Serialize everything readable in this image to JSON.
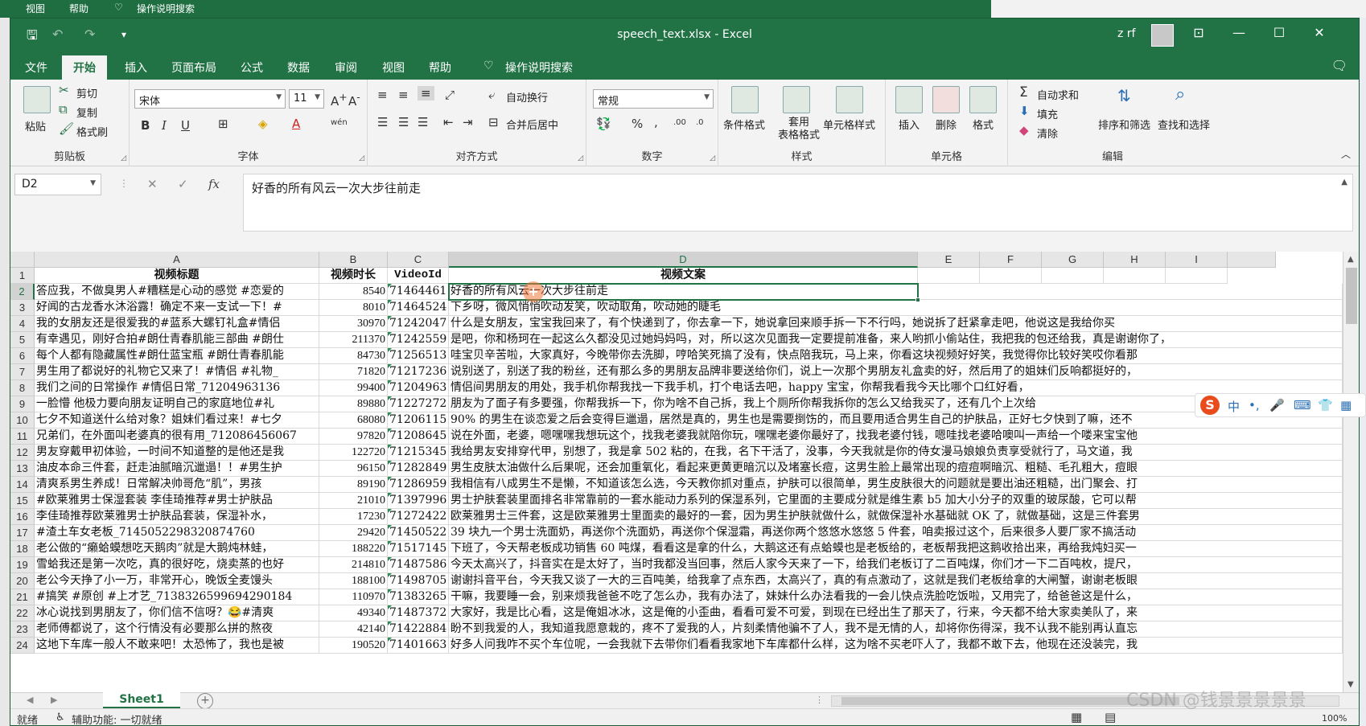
{
  "background": {
    "menu_view": "视图",
    "menu_help": "帮助",
    "tell_me": "操作说明搜索"
  },
  "window": {
    "title": "speech_text.xlsx - Excel",
    "user": "z rf",
    "accent": "#217346"
  },
  "tabs": [
    {
      "label": "文件",
      "active": false
    },
    {
      "label": "开始",
      "active": true
    },
    {
      "label": "插入",
      "active": false
    },
    {
      "label": "页面布局",
      "active": false
    },
    {
      "label": "公式",
      "active": false
    },
    {
      "label": "数据",
      "active": false
    },
    {
      "label": "审阅",
      "active": false
    },
    {
      "label": "视图",
      "active": false
    },
    {
      "label": "帮助",
      "active": false
    },
    {
      "label": "操作说明搜索",
      "active": false
    }
  ],
  "ribbon": {
    "clipboard": {
      "paste": "粘贴",
      "cut": "剪切",
      "copy": "复制",
      "format_painter": "格式刷",
      "label": "剪贴板"
    },
    "font": {
      "name": "宋体",
      "size": "11",
      "label": "字体",
      "bold": "B",
      "italic": "I",
      "underline": "U",
      "phonetic": "wén"
    },
    "alignment": {
      "wrap": "自动换行",
      "merge": "合并后居中",
      "label": "对齐方式"
    },
    "number": {
      "format": "常规",
      "percent": "%",
      "comma": ",",
      "label": "数字"
    },
    "styles": {
      "conditional": "条件格式",
      "table": "套用\n表格格式",
      "cell_styles": "单元格样式",
      "label": "样式"
    },
    "cells": {
      "insert": "插入",
      "delete": "删除",
      "format": "格式",
      "label": "单元格"
    },
    "editing": {
      "autosum": "自动求和",
      "fill": "填充",
      "clear": "清除",
      "sort": "排序和筛选",
      "find": "查找和选择",
      "label": "编辑"
    }
  },
  "formula_bar": {
    "name_box": "D2",
    "fx": "fx",
    "content": "好香的所有风云一次大步往前走"
  },
  "columns": [
    "A",
    "B",
    "C",
    "D",
    "E",
    "F",
    "G",
    "H",
    "I"
  ],
  "selected_column": "D",
  "selected_row": 2,
  "header_row": {
    "a": "视频标题",
    "b": "视频时长",
    "c": "VideoId",
    "d": "视频文案"
  },
  "rows": [
    {
      "num": "2",
      "a": "答应我，不做臭男人#糟糕是心动的感觉 #恋爱的",
      "b": "8540",
      "c": "71464461",
      "d": "好香的所有风云一次大步往前走"
    },
    {
      "num": "3",
      "a": "好闻的古龙香水沐浴露！确定不来一支试一下！#",
      "b": "8010",
      "c": "71464524",
      "d": "下乡呀，微风悄悄吹动发笑，吹动取角，吹动她的睫毛"
    },
    {
      "num": "4",
      "a": "我的女朋友还是很爱我的#蓝系大螺钉礼盒#情侣",
      "b": "30970",
      "c": "71242047",
      "d": "什么是女朋友，宝宝我回来了，有个快递到了，你去拿一下，她说拿回来顺手拆一下不行吗，她说拆了赶紧拿走吧，他说这是我给你买"
    },
    {
      "num": "5",
      "a": "有幸遇见，刚好合拍#朗仕青春肌能三部曲 #朗仕",
      "b": "211370",
      "c": "71242559",
      "d": "是吧，你和杨珂在一起这么久都没见过她妈妈吗，对，所以这次见面我一定要提前准备，来人哟抓小偷站住，我把我的包还给我，真是谢谢你了，"
    },
    {
      "num": "6",
      "a": "每个人都有隐藏属性#朗仕蓝宝瓶 #朗仕青春肌能",
      "b": "84730",
      "c": "71256513",
      "d": "哇宝贝辛苦啦，大家真好，今晚带你去洗脚，哼哈笑死搞了没有，快点陪我玩，马上来，你看这块视频好好笑，我觉得你比较好笑哎你看那"
    },
    {
      "num": "7",
      "a": "男生用了都说好的礼物它又来了！#情侣 #礼物_",
      "b": "71820",
      "c": "71217236",
      "d": "说别送了，别送了我的粉丝，还有那么多的男朋友品牌非要送给你们，说上一次那个男朋友礼盒卖的好，然后用了的姐妹们反响都挺好的，"
    },
    {
      "num": "8",
      "a": "我们之间的日常操作 #情侣日常_71204963136",
      "b": "99400",
      "c": "71204963",
      "d": "情侣间男朋友的用处，我手机你帮我找一下我手机，打个电话去吧，happy 宝宝，你帮我看我今天比哪个口红好看，"
    },
    {
      "num": "9",
      "a": "一脸懵  他极力要向朋友证明自己的家庭地位#礼",
      "b": "89880",
      "c": "71227272",
      "d": "朋友为了面子有多要强，你帮我拆一下，你为啥不自己拆，我上个厕所你帮我拆你的怎么又给我买了，还有几个上次给"
    },
    {
      "num": "10",
      "a": "七夕不知道送什么给对象？姐妹们看过来！#七夕",
      "b": "68080",
      "c": "71206115",
      "d": "90% 的男生在谈恋爱之后会变得巨邋遢，居然是真的，男生也是需要捯饬的，而且要用适合男生自己的护肤品，正好七夕快到了嘛，还不"
    },
    {
      "num": "11",
      "a": "兄弟们，在外面叫老婆真的很有用_712086456067",
      "b": "97820",
      "c": "71208645",
      "d": "说在外面，老婆，嗯嘿嘿我想玩这个，找我老婆我就陪你玩，嘿嘿老婆你最好了，找我老婆付钱，嗯哇找老婆哈噢叫一声给一个喽来宝宝他"
    },
    {
      "num": "12",
      "a": "男友穿戴甲初体验，一时间不知道整的是他还是我",
      "b": "122720",
      "c": "71215345",
      "d": "我给男友安排穿代甲，别想了，我是拿 502 粘的，在我，名下干活了，没事，今天我就是你的侍女漫马娘娘负责享受就行了，马文道，我"
    },
    {
      "num": "13",
      "a": "油皮本命三件套，赶走油腻暗沉邋遢！！#男生护",
      "b": "96150",
      "c": "71282849",
      "d": "男生皮肤太油做什么后果呢，还会加重氧化，看起来更黄更暗沉以及堵塞长痘，这男生脸上最常出现的痘痘啊暗沉、粗糙、毛孔粗大，痘眼"
    },
    {
      "num": "14",
      "a": "清爽系男生养成！日常解决帅哥危“肌”，男孩",
      "b": "89190",
      "c": "71286959",
      "d": "我相信有八成男生不是懒，不知道该怎么选，今天教你抓对重点，护肤可以很简单，男生皮肤很大的问题就是要出油还粗糙，出门聚会、打"
    },
    {
      "num": "15",
      "a": "#欧莱雅男士保湿套装 李佳琦推荐#男士护肤品",
      "b": "21010",
      "c": "71397996",
      "d": "男士护肤套装里面排名非常靠前的一套水能动力系列的保湿系列，它里面的主要成分就是维生素 b5 加大小分子的双重的玻尿酸，它可以帮"
    },
    {
      "num": "16",
      "a": "李佳琦推荐欧莱雅男士护肤品套装，保湿补水，",
      "b": "17230",
      "c": "71272422",
      "d": "欧莱雅男士三件套，这是欧莱雅男士里面卖的最好的一套，因为男生护肤就做什么，就做保湿补水基础就 OK 了，就做基础，这是三件套男"
    },
    {
      "num": "17",
      "a": "#渣土车女老板_7145052298320874760",
      "b": "29420",
      "c": "71450522",
      "d": "39 块九一个男士洗面奶，再送你个洗面奶，再送你个保湿霜，再送你两个悠悠水悠悠 5 件套，咱卖报过这个，后来很多人要厂家不搞活动"
    },
    {
      "num": "18",
      "a": "老公做的“癞蛤蟆想吃天鹅肉”就是大鹅炖林蛙，",
      "b": "188220",
      "c": "71517145",
      "d": "下班了，今天帮老板成功销售 60 吨煤，看看这是拿的什么，大鹅这还有点蛤蟆也是老板给的，老板帮我把这鹅收拾出来，再给我炖妇买一"
    },
    {
      "num": "19",
      "a": "雪蛤我还是第一次吃，真的很好吃，烧卖蒸的也好",
      "b": "214810",
      "c": "71487586",
      "d": "今天太高兴了，抖音实在是太好了，当时我都没当回事，然后人家今天来了一下，给我们老板订了二百吨煤，你们才一下二百吨枚，提尺，"
    },
    {
      "num": "20",
      "a": "老公今天挣了小一万，非常开心，晚饭全麦馒头",
      "b": "188100",
      "c": "71498705",
      "d": "谢谢抖音平台，今天我又谈了一大的三百吨美，给我拿了点东西，太高兴了，真的有点激动了，这就是我们老板给拿的大闸蟹，谢谢老板眼"
    },
    {
      "num": "21",
      "a": "#搞笑 #原创 #上才艺_7138326599694290184",
      "b": "110970",
      "c": "71383265",
      "d": "干嘛，我要睡一会，别来烦我爸爸不吃了怎么办，我有办法了，妹妹什么办法看我的一会儿快点洗脸吃饭啦，又用完了，给爸爸这是什么，"
    },
    {
      "num": "22",
      "a": "冰心说找到男朋友了，你们信不信呀？😂#清爽",
      "b": "49340",
      "c": "71487372",
      "d": "大家好，我是比心看，这是俺姐冰冰，这是俺的小歪曲，看看可爱不可爱，到现在已经出生了那天了，行来，今天都不给大家卖美队了，来"
    },
    {
      "num": "23",
      "a": "老师傅都说了，这个行情没有必要那么拼的熬夜",
      "b": "42140",
      "c": "71422884",
      "d": "盼不到我爱的人，我知道我愿意栽的，疼不了爱我的人，片刻柔情他骗不了人，我不是无情的人，却将你伤得深，我不认我不能别再认直忘"
    },
    {
      "num": "24",
      "a": "这地下车库一般人不敢来吧！太恐怖了，我也是被",
      "b": "190520",
      "c": "71401663",
      "d": "好多人问我咋不买个车位呢，一会我就下去带你们看看我家地下车库都什么样，这为啥不买老吓人了，我都不敢下去，他现在还没装完，我"
    }
  ],
  "sheet": {
    "name": "Sheet1",
    "add": "+"
  },
  "status": {
    "ready": "就绪",
    "accessibility": "辅助功能: 一切就绪",
    "zoom": "100%"
  },
  "watermark": "CSDN @钱景景景景景"
}
